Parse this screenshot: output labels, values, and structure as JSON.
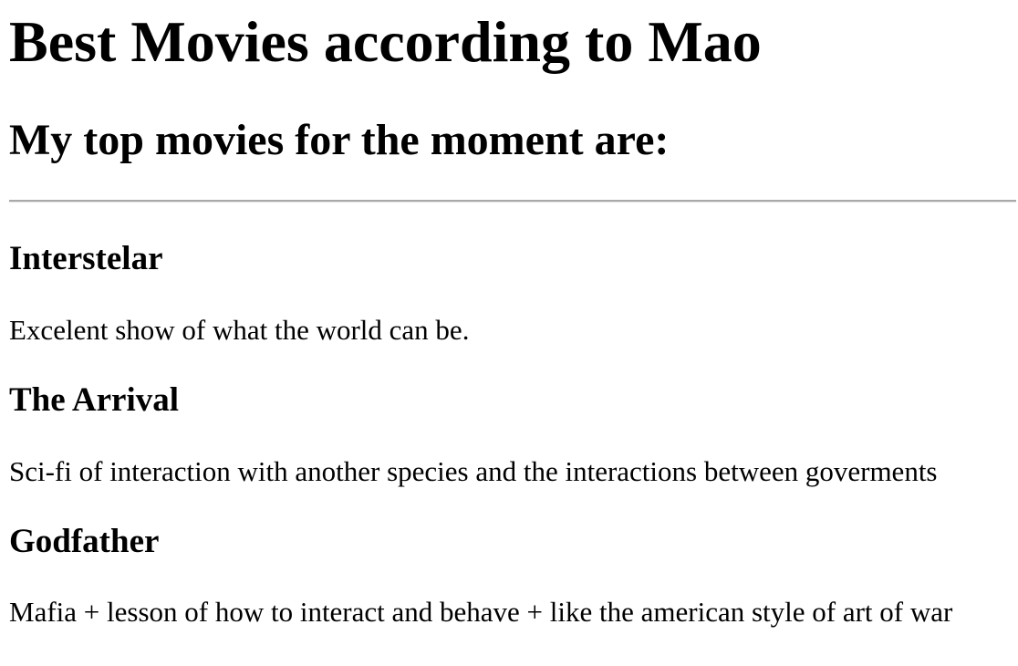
{
  "page": {
    "title": "Best Movies according to Mao",
    "subtitle": "My top movies for the moment are:"
  },
  "movies": [
    {
      "title": "Interstelar",
      "description": "Excelent show of what the world can be."
    },
    {
      "title": "The Arrival",
      "description": "Sci-fi of interaction with another species and the interactions between goverments"
    },
    {
      "title": "Godfather",
      "description": "Mafia + lesson of how to interact and behave + like the american style of art of war"
    }
  ],
  "colors": {
    "background": "#ffffff",
    "text": "#000000",
    "divider": "#a9a9a9"
  }
}
